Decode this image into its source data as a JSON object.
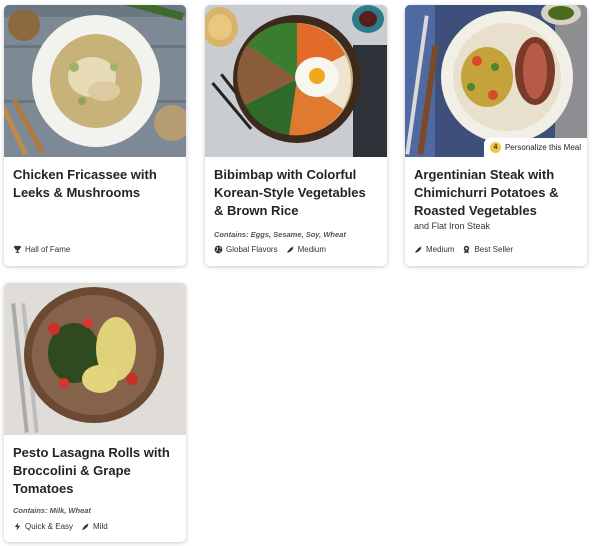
{
  "cards": [
    {
      "title": "Chicken Fricassee with Leeks & Mushrooms",
      "subtitle": "",
      "allergens": "",
      "tags": [
        "Hall of Fame"
      ]
    },
    {
      "title": "Bibimbap with Colorful Korean-Style Vegetables & Brown Rice",
      "subtitle": "",
      "allergens": "Contains: Eggs, Sesame, Soy, Wheat",
      "tags": [
        "Global Flavors",
        "Medium"
      ]
    },
    {
      "title": "Argentinian Steak with Chimichurri Potatoes & Roasted Vegetables",
      "subtitle": "and Flat Iron Steak",
      "allergens": "",
      "tags": [
        "Medium",
        "Best Seller"
      ],
      "personalize": {
        "count": "4",
        "label": "Personalize this Meal"
      }
    },
    {
      "title": "Pesto Lasagna Rolls with Broccolini & Grape Tomatoes",
      "subtitle": "",
      "allergens": "Contains: Milk, Wheat",
      "tags": [
        "Quick & Easy",
        "Mild"
      ]
    }
  ],
  "icons": {
    "hall_of_fame": "trophy-icon",
    "global_flavors": "globe-icon",
    "spice": "chili-icon",
    "best_seller": "ribbon-icon",
    "quick": "lightning-icon"
  },
  "colors": {
    "badge": "#f2c53d"
  }
}
